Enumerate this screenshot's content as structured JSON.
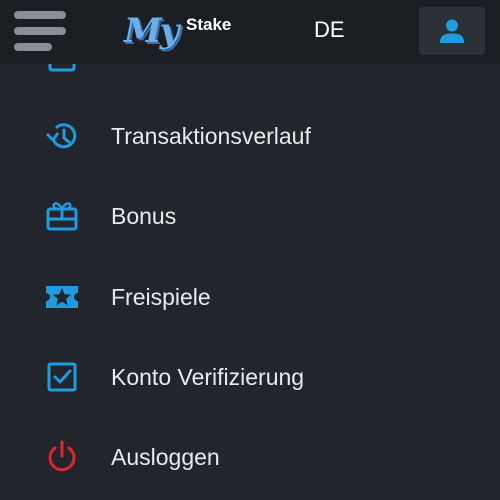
{
  "header": {
    "logo_main": "My",
    "logo_sub": "Stake",
    "language": "DE"
  },
  "menu": {
    "items": [
      {
        "label": "Transaktionsverlauf",
        "icon": "history-icon"
      },
      {
        "label": "Bonus",
        "icon": "gift-icon"
      },
      {
        "label": "Freispiele",
        "icon": "ticket-star-icon"
      },
      {
        "label": "Konto Verifizierung",
        "icon": "checkbox-icon"
      },
      {
        "label": "Ausloggen",
        "icon": "power-icon"
      }
    ]
  },
  "colors": {
    "accent": "#1f9be0",
    "logout": "#e0262b",
    "text": "#e8eaed",
    "background": "#22252b",
    "header_bg": "#1b1e23"
  }
}
